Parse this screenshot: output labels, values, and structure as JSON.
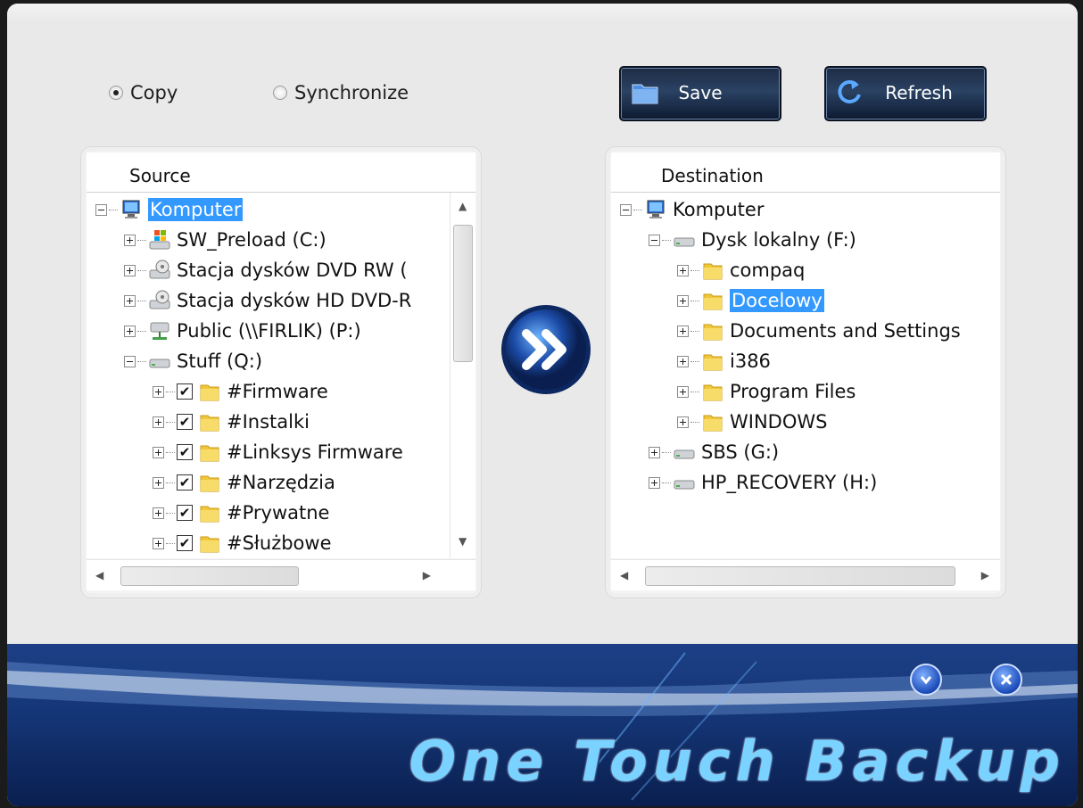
{
  "mode_options": [
    {
      "label": "Copy",
      "selected": true
    },
    {
      "label": "Synchronize",
      "selected": false
    }
  ],
  "buttons": {
    "save": "Save",
    "refresh": "Refresh"
  },
  "source": {
    "header": "Source",
    "items": [
      {
        "label": "Komputer",
        "icon": "computer-icon",
        "level": 0,
        "expander": "minus",
        "selected": true
      },
      {
        "label": "SW_Preload (C:)",
        "icon": "windows-drive-icon",
        "level": 1,
        "expander": "plus"
      },
      {
        "label": "Stacja dysków DVD RW (",
        "icon": "optical-drive-icon",
        "level": 1,
        "expander": "plus"
      },
      {
        "label": "Stacja dysków HD DVD-R",
        "icon": "optical-drive-icon",
        "level": 1,
        "expander": "plus"
      },
      {
        "label": "Public (\\\\FIRLIK) (P:)",
        "icon": "network-drive-icon",
        "level": 1,
        "expander": "plus"
      },
      {
        "label": "Stuff (Q:)",
        "icon": "drive-icon",
        "level": 1,
        "expander": "minus"
      },
      {
        "label": "#Firmware",
        "icon": "folder-icon",
        "level": 2,
        "expander": "plus",
        "checked": true
      },
      {
        "label": "#Instalki",
        "icon": "folder-icon",
        "level": 2,
        "expander": "plus",
        "checked": true
      },
      {
        "label": "#Linksys Firmware",
        "icon": "folder-icon",
        "level": 2,
        "expander": "plus",
        "checked": true
      },
      {
        "label": "#Narzędzia",
        "icon": "folder-icon",
        "level": 2,
        "expander": "plus",
        "checked": true
      },
      {
        "label": "#Prywatne",
        "icon": "folder-icon",
        "level": 2,
        "expander": "plus",
        "checked": true
      },
      {
        "label": "#Służbowe",
        "icon": "folder-icon",
        "level": 2,
        "expander": "plus",
        "checked": true
      }
    ]
  },
  "destination": {
    "header": "Destination",
    "items": [
      {
        "label": "Komputer",
        "icon": "computer-icon",
        "level": 0,
        "expander": "minus"
      },
      {
        "label": "Dysk lokalny (F:)",
        "icon": "drive-icon",
        "level": 1,
        "expander": "minus"
      },
      {
        "label": "compaq",
        "icon": "folder-icon",
        "level": 2,
        "expander": "plus"
      },
      {
        "label": "Docelowy",
        "icon": "folder-icon",
        "level": 2,
        "expander": "plus",
        "selected": true
      },
      {
        "label": "Documents and Settings",
        "icon": "folder-icon",
        "level": 2,
        "expander": "plus"
      },
      {
        "label": "i386",
        "icon": "folder-icon",
        "level": 2,
        "expander": "plus"
      },
      {
        "label": "Program Files",
        "icon": "folder-icon",
        "level": 2,
        "expander": "plus"
      },
      {
        "label": "WINDOWS",
        "icon": "folder-icon",
        "level": 2,
        "expander": "plus"
      },
      {
        "label": "SBS (G:)",
        "icon": "drive-icon",
        "level": 1,
        "expander": "plus"
      },
      {
        "label": "HP_RECOVERY (H:)",
        "icon": "drive-icon",
        "level": 1,
        "expander": "plus"
      }
    ]
  },
  "branding": {
    "title": "One Touch Backup"
  },
  "colors": {
    "selection": "#3399ff",
    "button_dark": "#1d2c44",
    "banner": "#143575",
    "brand_text": "#79d2ff"
  }
}
